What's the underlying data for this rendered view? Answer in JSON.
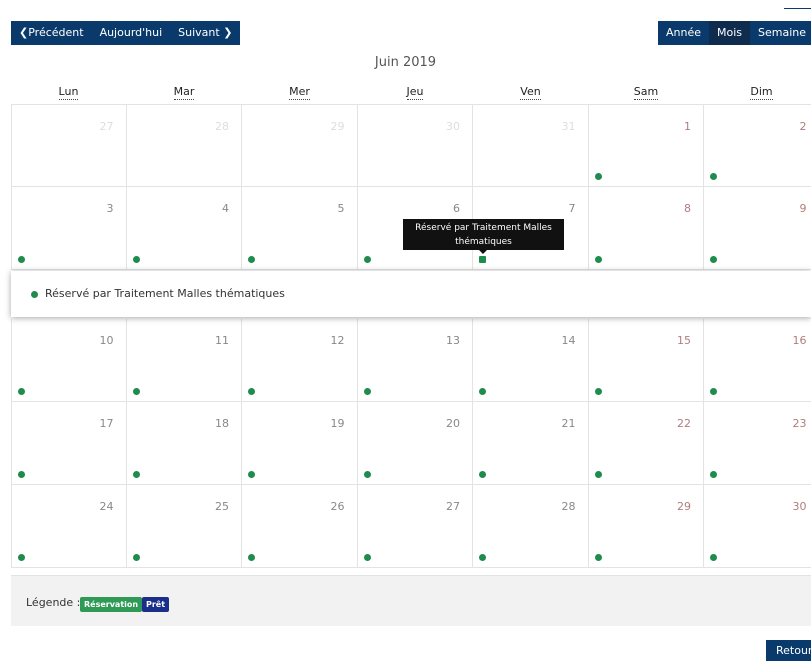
{
  "nav": {
    "prev_label": "❮Précédent",
    "today_label": "Aujourd'hui",
    "next_label": "Suivant ❯"
  },
  "views": {
    "year_label": "Année",
    "month_label": "Mois",
    "week_label": "Semaine",
    "active": "Mois"
  },
  "calendar": {
    "title": "Juin 2019",
    "weekdays": [
      "Lun",
      "Mar",
      "Mer",
      "Jeu",
      "Ven",
      "Sam",
      "Dim"
    ],
    "weeks": [
      [
        "27",
        "28",
        "29",
        "30",
        "31",
        "1",
        "2"
      ],
      [
        "3",
        "4",
        "5",
        "6",
        "7",
        "8",
        "9"
      ],
      [
        "10",
        "11",
        "12",
        "13",
        "14",
        "15",
        "16"
      ],
      [
        "17",
        "18",
        "19",
        "20",
        "21",
        "22",
        "23"
      ],
      [
        "24",
        "25",
        "26",
        "27",
        "28",
        "29",
        "30"
      ]
    ]
  },
  "tooltip": {
    "line1": "Réservé par Traitement Malles",
    "line2": "thématiques"
  },
  "event_detail": {
    "text": "Réservé par Traitement Malles thématiques"
  },
  "legend": {
    "label": "Légende :",
    "reservation": "Réservation",
    "pret": "Prêt"
  },
  "colors": {
    "nav_bg": "#0a3a6b",
    "event_dot": "#1f8b4c",
    "reservation_badge": "#2e9a55",
    "pret_badge": "#1a2f8a"
  },
  "retour_label": "Retour"
}
